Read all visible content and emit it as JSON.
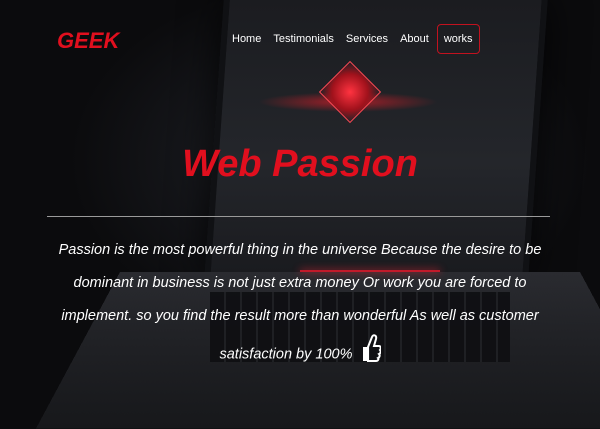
{
  "brand": {
    "logo": "GEEK",
    "accent": "#e10f1e"
  },
  "nav": {
    "items": [
      {
        "label": "Home"
      },
      {
        "label": "Testimonials"
      },
      {
        "label": "Services"
      },
      {
        "label": "About"
      },
      {
        "label": "works"
      }
    ]
  },
  "hero": {
    "title": "Web Passion",
    "paragraph": "Passion is the most powerful thing in the universe Because the desire to be dominant in business is not just extra money    Or work you are forced to implement. so you find the result more than wonderful As well as customer satisfaction by 100%",
    "icon": "thumbs-up-icon"
  }
}
